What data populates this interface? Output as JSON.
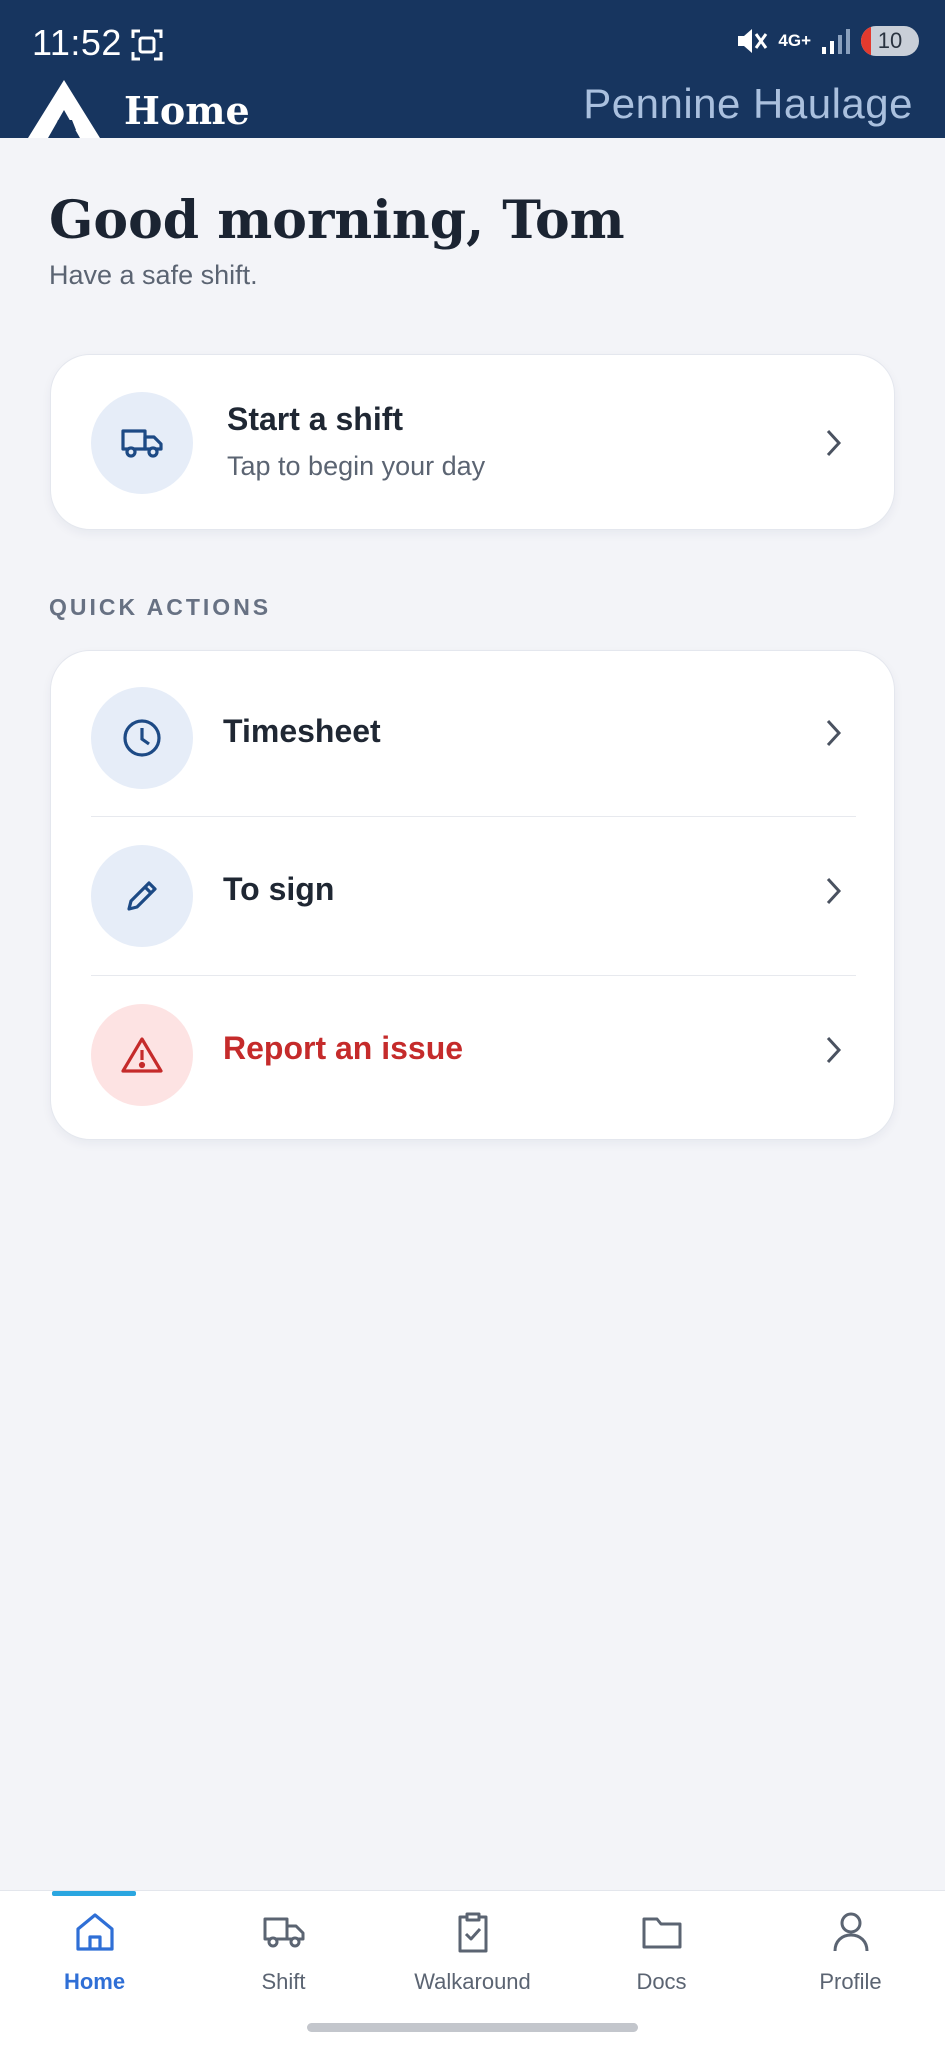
{
  "status_bar": {
    "time": "11:52",
    "network": "4G+",
    "battery": "10"
  },
  "header": {
    "title": "Home",
    "company": "Pennine Haulage"
  },
  "greeting": {
    "title": "Good morning, Tom",
    "subtitle": "Have a safe shift."
  },
  "shift_card": {
    "title": "Start a shift",
    "subtitle": "Tap to begin your day",
    "icon": "truck-icon"
  },
  "quick_actions": {
    "label": "QUICK ACTIONS",
    "items": [
      {
        "label": "Timesheet",
        "icon": "clock-icon"
      },
      {
        "label": "To sign",
        "icon": "pencil-icon"
      },
      {
        "label": "Report an issue",
        "icon": "warning-icon"
      }
    ]
  },
  "bottom_nav": {
    "items": [
      {
        "label": "Home",
        "icon": "home-icon",
        "active": true
      },
      {
        "label": "Shift",
        "icon": "truck-icon"
      },
      {
        "label": "Walkaround",
        "icon": "clipboard-check-icon"
      },
      {
        "label": "Docs",
        "icon": "folder-icon"
      },
      {
        "label": "Profile",
        "icon": "user-icon"
      }
    ]
  },
  "colors": {
    "header_bg": "#17355f",
    "accent": "#2f6fd6",
    "danger": "#c52b2b",
    "page_bg": "#f3f4f8"
  }
}
